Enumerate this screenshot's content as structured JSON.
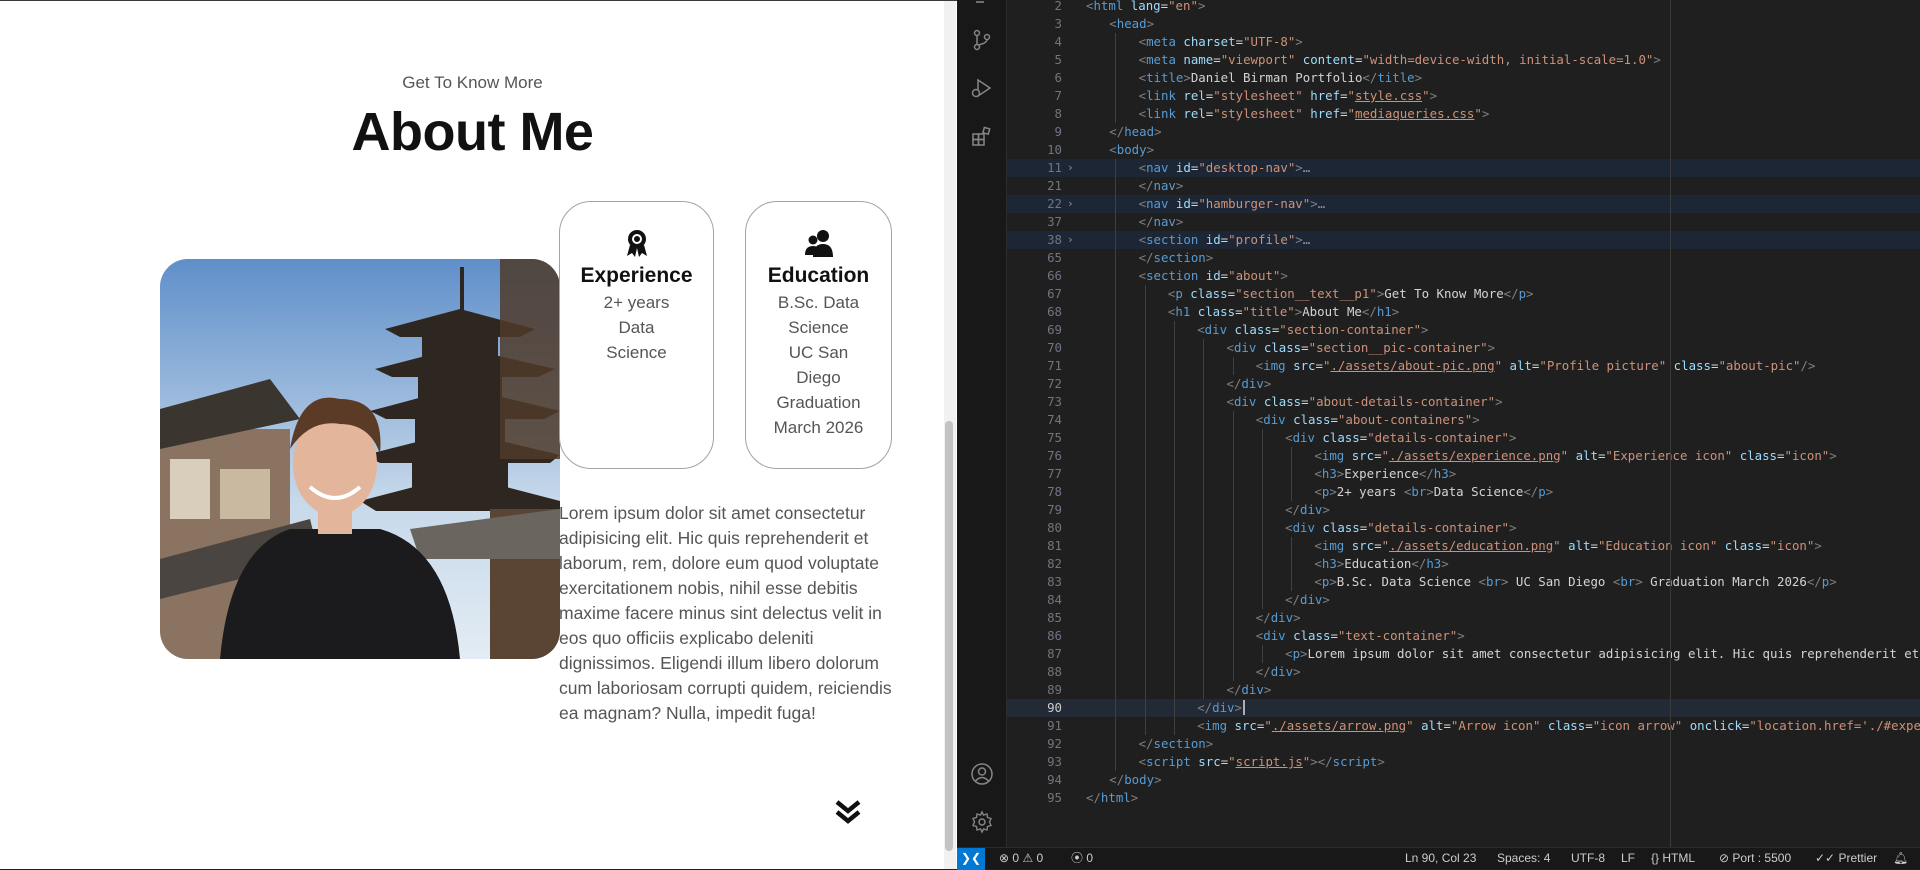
{
  "preview": {
    "section_text": "Get To Know More",
    "title": "About Me",
    "experience": {
      "title": "Experience",
      "lines": [
        "2+ years",
        "Data",
        "Science"
      ]
    },
    "education": {
      "title": "Education",
      "lines": [
        "B.Sc. Data",
        "Science",
        "UC San",
        "Diego",
        "Graduation",
        "March 2026"
      ]
    },
    "paragraph": "Lorem ipsum dolor sit amet consectetur adipisicing elit. Hic quis reprehenderit et laborum, rem, dolore eum quod voluptate exercitationem nobis, nihil esse debitis maxime facere minus sint delectus velit in eos quo officiis explicabo deleniti dignissimos. Eligendi illum libero dolorum cum laboriosam corrupti quidem, reiciendis ea magnam? Nulla, impedit fuga!"
  },
  "editor": {
    "current_line": 90,
    "lines": [
      {
        "n": "2",
        "indent": 0,
        "html": "<span class='tag-b'>&lt;</span><span class='tag'>html</span> <span class='attr'>lang</span>=<span class='str'>\"en\"</span><span class='tag-b'>&gt;</span>"
      },
      {
        "n": "3",
        "indent": 1,
        "html": "<span class='tag-b'>&lt;</span><span class='tag'>head</span><span class='tag-b'>&gt;</span>"
      },
      {
        "n": "4",
        "indent": 2,
        "html": "<span class='tag-b'>&lt;</span><span class='tag'>meta</span> <span class='attr'>charset</span>=<span class='str'>\"UTF-8\"</span><span class='tag-b'>&gt;</span>"
      },
      {
        "n": "5",
        "indent": 2,
        "html": "<span class='tag-b'>&lt;</span><span class='tag'>meta</span> <span class='attr'>name</span>=<span class='str'>\"viewport\"</span> <span class='attr'>content</span>=<span class='str'>\"width=device-width, initial-scale=1.0\"</span><span class='tag-b'>&gt;</span>"
      },
      {
        "n": "6",
        "indent": 2,
        "html": "<span class='tag-b'>&lt;</span><span class='tag'>title</span><span class='tag-b'>&gt;</span><span class='txt'>Daniel Birman Portfolio</span><span class='tag-b'>&lt;/</span><span class='tag'>title</span><span class='tag-b'>&gt;</span>"
      },
      {
        "n": "7",
        "indent": 2,
        "html": "<span class='tag-b'>&lt;</span><span class='tag'>link</span> <span class='attr'>rel</span>=<span class='str'>\"stylesheet\"</span> <span class='attr'>href</span>=<span class='str'>\"</span><span class='str-u'>style.css</span><span class='str'>\"</span><span class='tag-b'>&gt;</span>"
      },
      {
        "n": "8",
        "indent": 2,
        "html": "<span class='tag-b'>&lt;</span><span class='tag'>link</span> <span class='attr'>rel</span>=<span class='str'>\"stylesheet\"</span> <span class='attr'>href</span>=<span class='str'>\"</span><span class='str-u'>mediaqueries.css</span><span class='str'>\"</span><span class='tag-b'>&gt;</span>"
      },
      {
        "n": "9",
        "indent": 1,
        "html": "<span class='tag-b'>&lt;/</span><span class='tag'>head</span><span class='tag-b'>&gt;</span>"
      },
      {
        "n": "10",
        "indent": 1,
        "html": "<span class='tag-b'>&lt;</span><span class='tag'>body</span><span class='tag-b'>&gt;</span>"
      },
      {
        "n": "11",
        "indent": 2,
        "fold": true,
        "hl": true,
        "html": "<span class='tag-b'>&lt;</span><span class='tag'>nav</span> <span class='attr'>id</span>=<span class='str'>\"desktop-nav\"</span><span class='tag-b'>&gt;</span><span class='fold-dots'>…</span>"
      },
      {
        "n": "21",
        "indent": 2,
        "html": "<span class='tag-b'>&lt;/</span><span class='tag'>nav</span><span class='tag-b'>&gt;</span>"
      },
      {
        "n": "22",
        "indent": 2,
        "fold": true,
        "hl": true,
        "html": "<span class='tag-b'>&lt;</span><span class='tag'>nav</span> <span class='attr'>id</span>=<span class='str'>\"hamburger-nav\"</span><span class='tag-b'>&gt;</span><span class='fold-dots'>…</span>"
      },
      {
        "n": "37",
        "indent": 2,
        "html": "<span class='tag-b'>&lt;/</span><span class='tag'>nav</span><span class='tag-b'>&gt;</span>"
      },
      {
        "n": "38",
        "indent": 2,
        "fold": true,
        "hl": true,
        "html": "<span class='tag-b'>&lt;</span><span class='tag'>section</span> <span class='attr'>id</span>=<span class='str'>\"profile\"</span><span class='tag-b'>&gt;</span><span class='fold-dots'>…</span>"
      },
      {
        "n": "65",
        "indent": 2,
        "html": "<span class='tag-b'>&lt;/</span><span class='tag'>section</span><span class='tag-b'>&gt;</span>"
      },
      {
        "n": "66",
        "indent": 2,
        "html": "<span class='tag-b'>&lt;</span><span class='tag'>section</span> <span class='attr'>id</span>=<span class='str'>\"about\"</span><span class='tag-b'>&gt;</span>"
      },
      {
        "n": "67",
        "indent": 3,
        "html": "<span class='tag-b'>&lt;</span><span class='tag'>p</span> <span class='attr'>class</span>=<span class='str'>\"section__text__p1\"</span><span class='tag-b'>&gt;</span><span class='txt'>Get To Know More</span><span class='tag-b'>&lt;/</span><span class='tag'>p</span><span class='tag-b'>&gt;</span>"
      },
      {
        "n": "68",
        "indent": 3,
        "html": "<span class='tag-b'>&lt;</span><span class='tag'>h1</span> <span class='attr'>class</span>=<span class='str'>\"title\"</span><span class='tag-b'>&gt;</span><span class='txt'>About Me</span><span class='tag-b'>&lt;/</span><span class='tag'>h1</span><span class='tag-b'>&gt;</span>"
      },
      {
        "n": "69",
        "indent": 4,
        "html": "<span class='tag-b'>&lt;</span><span class='tag'>div</span> <span class='attr'>class</span>=<span class='str'>\"section-container\"</span><span class='tag-b'>&gt;</span>"
      },
      {
        "n": "70",
        "indent": 5,
        "html": "<span class='tag-b'>&lt;</span><span class='tag'>div</span> <span class='attr'>class</span>=<span class='str'>\"section__pic-container\"</span><span class='tag-b'>&gt;</span>"
      },
      {
        "n": "71",
        "indent": 6,
        "html": "<span class='tag-b'>&lt;</span><span class='tag'>img</span> <span class='attr'>src</span>=<span class='str'>\"</span><span class='str-u'>./assets/about-pic.png</span><span class='str'>\"</span> <span class='attr'>alt</span>=<span class='str'>\"Profile picture\"</span> <span class='attr'>class</span>=<span class='str'>\"about-pic\"</span><span class='tag-b'>/&gt;</span>"
      },
      {
        "n": "72",
        "indent": 5,
        "html": "<span class='tag-b'>&lt;/</span><span class='tag'>div</span><span class='tag-b'>&gt;</span>"
      },
      {
        "n": "73",
        "indent": 5,
        "html": "<span class='tag-b'>&lt;</span><span class='tag'>div</span> <span class='attr'>class</span>=<span class='str'>\"about-details-container\"</span><span class='tag-b'>&gt;</span>"
      },
      {
        "n": "74",
        "indent": 6,
        "html": "<span class='tag-b'>&lt;</span><span class='tag'>div</span> <span class='attr'>class</span>=<span class='str'>\"about-containers\"</span><span class='tag-b'>&gt;</span>"
      },
      {
        "n": "75",
        "indent": 7,
        "html": "<span class='tag-b'>&lt;</span><span class='tag'>div</span> <span class='attr'>class</span>=<span class='str'>\"details-container\"</span><span class='tag-b'>&gt;</span>"
      },
      {
        "n": "76",
        "indent": 8,
        "html": "<span class='tag-b'>&lt;</span><span class='tag'>img</span> <span class='attr'>src</span>=<span class='str'>\"</span><span class='str-u'>./assets/experience.png</span><span class='str'>\"</span> <span class='attr'>alt</span>=<span class='str'>\"Experience icon\"</span> <span class='attr'>class</span>=<span class='str'>\"icon\"</span><span class='tag-b'>&gt;</span>"
      },
      {
        "n": "77",
        "indent": 8,
        "html": "<span class='tag-b'>&lt;</span><span class='tag'>h3</span><span class='tag-b'>&gt;</span><span class='txt'>Experience</span><span class='tag-b'>&lt;/</span><span class='tag'>h3</span><span class='tag-b'>&gt;</span>"
      },
      {
        "n": "78",
        "indent": 8,
        "html": "<span class='tag-b'>&lt;</span><span class='tag'>p</span><span class='tag-b'>&gt;</span><span class='txt'>2+ years </span><span class='tag-b'>&lt;</span><span class='tag'>br</span><span class='tag-b'>&gt;</span><span class='txt'>Data Science</span><span class='tag-b'>&lt;/</span><span class='tag'>p</span><span class='tag-b'>&gt;</span>"
      },
      {
        "n": "79",
        "indent": 7,
        "html": "<span class='tag-b'>&lt;/</span><span class='tag'>div</span><span class='tag-b'>&gt;</span>"
      },
      {
        "n": "80",
        "indent": 7,
        "html": "<span class='tag-b'>&lt;</span><span class='tag'>div</span> <span class='attr'>class</span>=<span class='str'>\"details-container\"</span><span class='tag-b'>&gt;</span>"
      },
      {
        "n": "81",
        "indent": 8,
        "html": "<span class='tag-b'>&lt;</span><span class='tag'>img</span> <span class='attr'>src</span>=<span class='str'>\"</span><span class='str-u'>./assets/education.png</span><span class='str'>\"</span> <span class='attr'>alt</span>=<span class='str'>\"Education icon\"</span> <span class='attr'>class</span>=<span class='str'>\"icon\"</span><span class='tag-b'>&gt;</span>"
      },
      {
        "n": "82",
        "indent": 8,
        "html": "<span class='tag-b'>&lt;</span><span class='tag'>h3</span><span class='tag-b'>&gt;</span><span class='txt'>Education</span><span class='tag-b'>&lt;/</span><span class='tag'>h3</span><span class='tag-b'>&gt;</span>"
      },
      {
        "n": "83",
        "indent": 8,
        "html": "<span class='tag-b'>&lt;</span><span class='tag'>p</span><span class='tag-b'>&gt;</span><span class='txt'>B.Sc. Data Science </span><span class='tag-b'>&lt;</span><span class='tag'>br</span><span class='tag-b'>&gt;</span><span class='txt'> UC San Diego </span><span class='tag-b'>&lt;</span><span class='tag'>br</span><span class='tag-b'>&gt;</span><span class='txt'> Graduation March 2026</span><span class='tag-b'>&lt;/</span><span class='tag'>p</span><span class='tag-b'>&gt;</span>"
      },
      {
        "n": "84",
        "indent": 7,
        "html": "<span class='tag-b'>&lt;/</span><span class='tag'>div</span><span class='tag-b'>&gt;</span>"
      },
      {
        "n": "85",
        "indent": 6,
        "html": "<span class='tag-b'>&lt;/</span><span class='tag'>div</span><span class='tag-b'>&gt;</span>"
      },
      {
        "n": "86",
        "indent": 6,
        "html": "<span class='tag-b'>&lt;</span><span class='tag'>div</span> <span class='attr'>class</span>=<span class='str'>\"text-container\"</span><span class='tag-b'>&gt;</span>"
      },
      {
        "n": "87",
        "indent": 7,
        "html": "<span class='tag-b'>&lt;</span><span class='tag'>p</span><span class='tag-b'>&gt;</span><span class='txt'>Lorem ipsum dolor sit amet consectetur adipisicing elit. Hic quis reprehenderit et lab</span>"
      },
      {
        "n": "88",
        "indent": 6,
        "html": "<span class='tag-b'>&lt;/</span><span class='tag'>div</span><span class='tag-b'>&gt;</span>"
      },
      {
        "n": "89",
        "indent": 5,
        "html": "<span class='tag-b'>&lt;/</span><span class='tag'>div</span><span class='tag-b'>&gt;</span>"
      },
      {
        "n": "90",
        "indent": 4,
        "html": "<span class='tag-b'>&lt;/</span><span class='tag'>div</span><span class='tag-b'>&gt;</span>"
      },
      {
        "n": "91",
        "indent": 4,
        "html": "<span class='tag-b'>&lt;</span><span class='tag'>img</span> <span class='attr'>src</span>=<span class='str'>\"</span><span class='str-u'>./assets/arrow.png</span><span class='str'>\"</span> <span class='attr'>alt</span>=<span class='str'>\"Arrow icon\"</span> <span class='attr'>class</span>=<span class='str'>\"icon arrow\"</span> <span class='attr'>onclick</span>=<span class='str'>\"location.href='./#experien</span>"
      },
      {
        "n": "92",
        "indent": 2,
        "html": "<span class='tag-b'>&lt;/</span><span class='tag'>section</span><span class='tag-b'>&gt;</span>"
      },
      {
        "n": "93",
        "indent": 2,
        "html": "<span class='tag-b'>&lt;</span><span class='tag'>script</span> <span class='attr'>src</span>=<span class='str'>\"</span><span class='str-u'>script.js</span><span class='str'>\"</span><span class='tag-b'>&gt;&lt;/</span><span class='tag'>script</span><span class='tag-b'>&gt;</span>"
      },
      {
        "n": "94",
        "indent": 1,
        "html": "<span class='tag-b'>&lt;/</span><span class='tag'>body</span><span class='tag-b'>&gt;</span>"
      },
      {
        "n": "95",
        "indent": 0,
        "html": "<span class='tag-b'>&lt;/</span><span class='tag'>html</span><span class='tag-b'>&gt;</span>"
      }
    ]
  },
  "statusbar": {
    "errors": "0",
    "warnings": "0",
    "ports_count": "0",
    "cursor": "Ln 90, Col 23",
    "spaces": "Spaces: 4",
    "encoding": "UTF-8",
    "eol": "LF",
    "language": "{} HTML",
    "port": "Port : 5500",
    "prettier": "Prettier"
  },
  "icons": {
    "activity": [
      "source-control-icon",
      "run-debug-icon",
      "extensions-icon",
      "account-icon",
      "settings-gear-icon"
    ]
  }
}
